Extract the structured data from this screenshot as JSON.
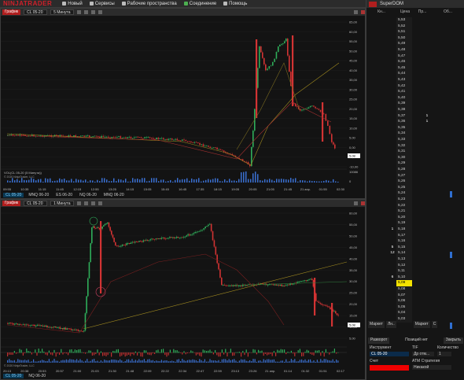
{
  "menubar": {
    "logo": "NINJATRADER",
    "items": [
      "Новый",
      "Сервисы",
      "Рабочие пространства",
      "Соединение",
      "Помощь"
    ]
  },
  "chart_top": {
    "tag": "График",
    "instrument": "CL 05-20",
    "interval": "5 Минута",
    "volume_label": "VOL(CL 05-20 (5 Минута))",
    "copyright": "© 2020 NinjaTrader, LLC",
    "price_axis": [
      "65,00",
      "60,00",
      "55,00",
      "50,00",
      "45,00",
      "40,00",
      "35,00",
      "30,00",
      "25,00",
      "20,00",
      "15,00",
      "10,00",
      "5,00",
      "0,00",
      "-5,00",
      "-10,00"
    ],
    "current_price": "5,08",
    "volume_axis": [
      "10086",
      "0"
    ],
    "time_axis": [
      "09:55",
      "10:35",
      "11:15",
      "11:45",
      "12:15",
      "12:55",
      "13:25",
      "14:15",
      "15:05",
      "15:45",
      "16:45",
      "17:35",
      "18:15",
      "19:05",
      "20:05",
      "21:05",
      "21:45",
      "21 апр.",
      "01:55",
      "02:30"
    ],
    "tabs": [
      "CL 05-20",
      "MNQ 06-20",
      "ES 06-20",
      "NQ 06-20",
      "MNQ 06-20"
    ]
  },
  "chart_bottom": {
    "tag": "График",
    "instrument": "CL 05-20",
    "interval": "1 Минута",
    "copyright": "© 2020 NinjaTrader, LLC",
    "price_axis": [
      "60,00",
      "55,00",
      "50,00",
      "45,00",
      "40,00",
      "35,00",
      "30,00",
      "25,00",
      "20,00",
      "15,00",
      "10,00",
      "5,00"
    ],
    "current_price": "5,08",
    "time_axis": [
      "20:13",
      "20:38",
      "20:53",
      "20:57",
      "21:00",
      "21:03",
      "21:30",
      "21:48",
      "22:09",
      "22:22",
      "22:34",
      "22:47",
      "22:59",
      "23:13",
      "23:26",
      "21 апр.",
      "01:14",
      "01:32",
      "01:51",
      "02:17"
    ],
    "tabs": [
      "CL 05-20",
      "NQ 06-20"
    ]
  },
  "superdom": {
    "title": "SuperDOM",
    "headers": [
      "Кн...",
      "Цена",
      "Пр...",
      "Об..."
    ],
    "prices": [
      "5,53",
      "5,52",
      "5,51",
      "5,50",
      "5,49",
      "5,48",
      "5,47",
      "5,46",
      "5,45",
      "5,44",
      "5,43",
      "5,42",
      "5,41",
      "5,40",
      "5,39",
      "5,38",
      "5,37",
      "5,36",
      "5,35",
      "5,34",
      "5,33",
      "5,32",
      "5,31",
      "5,30",
      "5,29",
      "5,28",
      "5,27",
      "5,26",
      "5,25",
      "5,24",
      "5,23",
      "5,22",
      "5,21",
      "5,20",
      "5,19",
      "5,18",
      "5,17",
      "5,16",
      "5,15",
      "5,14",
      "5,13",
      "5,12",
      "5,11",
      "5,10",
      "5,09",
      "5,08",
      "5,07",
      "5,06",
      "5,05",
      "5,04",
      "5,03"
    ],
    "asks": {
      "5,37": "1",
      "5,36": "1"
    },
    "bids": {
      "5,18": "1",
      "5,15": "5",
      "5,14": "12",
      "5,10": "6"
    },
    "last_price": "5,09",
    "market_buttons": [
      "Маркет",
      "Лн..",
      "Маркет",
      "С"
    ],
    "tabs": [
      "Разворот",
      "Позиций нет",
      "Закрыть"
    ],
    "instrument_label": "Инструмент",
    "tif_label": "TIF",
    "qty_label": "Количество",
    "instrument": "CL 05-20",
    "tif": "Др отм...",
    "qty": "1",
    "strategy_label": "ATM Стратегия",
    "account_label": "Счет",
    "strategy": "Никакой"
  },
  "colors": {
    "up": "#2fae5a",
    "down": "#d23333",
    "accent": "#b01e1e",
    "last": "#f5e200"
  }
}
